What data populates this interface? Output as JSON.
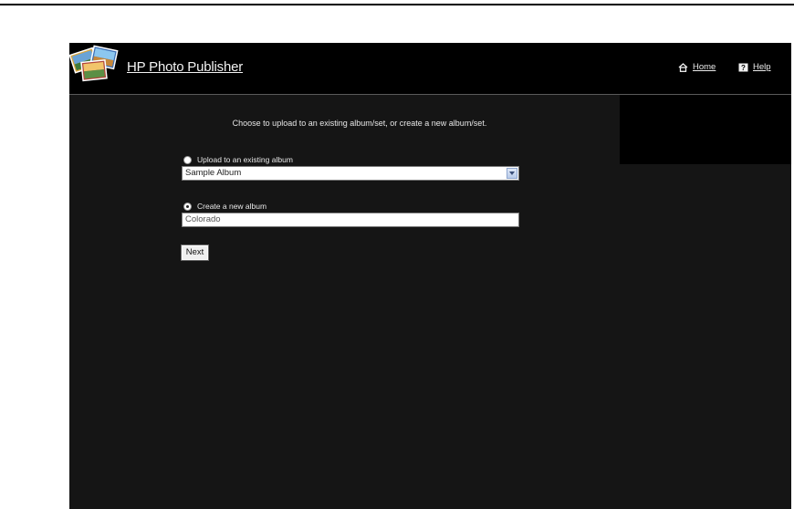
{
  "header": {
    "app_title": "HP Photo Publisher",
    "nav": {
      "home_label": "Home",
      "help_label": "Help"
    }
  },
  "form": {
    "instruction": "Choose to upload to an existing album/set, or create a new album/set.",
    "existing_option": {
      "label": "Upload to an existing album",
      "selected": false,
      "select_value": "Sample Album"
    },
    "new_option": {
      "label": "Create a new album",
      "selected": true,
      "input_value": "Colorado"
    },
    "next_label": "Next"
  },
  "icons": {
    "logo": "photo-stack-logo-icon",
    "home": "home-icon",
    "help": "help-icon"
  },
  "colors": {
    "header_bg": "#000000",
    "content_bg": "#151515",
    "text": "#e8e8e8"
  }
}
